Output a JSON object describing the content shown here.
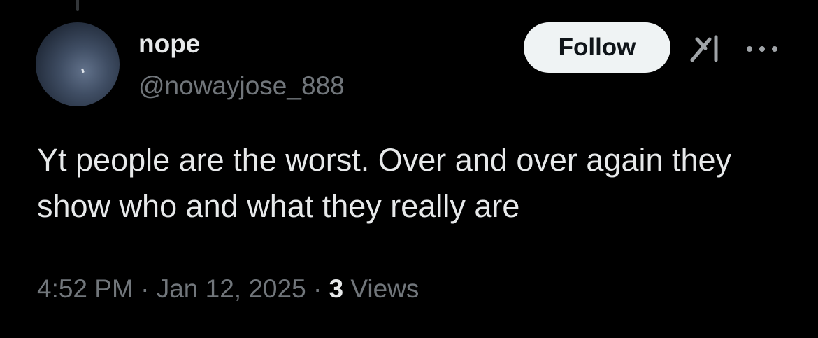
{
  "author": {
    "display_name": "nope",
    "handle": "@nowayjose_888",
    "avatar_icon": "avatar-dark-sky"
  },
  "actions": {
    "follow_label": "Follow",
    "grok_icon": "grok-icon",
    "more_icon": "more-dots-icon"
  },
  "tweet": {
    "text": "Yt people are the worst. Over and over again they show who and what they really are"
  },
  "meta": {
    "time": "4:52 PM",
    "separator": "·",
    "date": "Jan 12, 2025",
    "views_count": "3",
    "views_label": "Views"
  },
  "colors": {
    "background": "#000000",
    "primary_text": "#e7e9ea",
    "secondary_text": "#71767b",
    "follow_bg": "#eff3f4",
    "follow_text": "#0f1419"
  }
}
